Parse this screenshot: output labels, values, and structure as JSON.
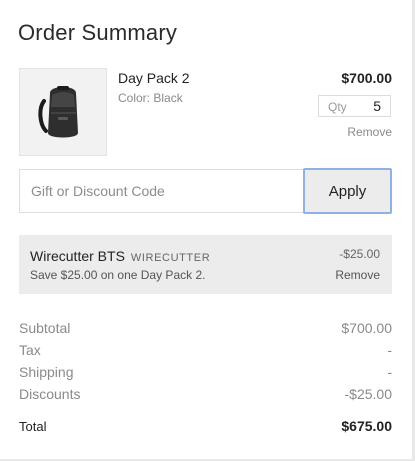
{
  "header": {
    "title": "Order Summary"
  },
  "item": {
    "name": "Day Pack 2",
    "variant": "Color: Black",
    "price": "$700.00",
    "qty_label": "Qty",
    "qty_value": "5",
    "remove_label": "Remove",
    "image_icon": "backpack-image"
  },
  "discount_form": {
    "placeholder": "Gift or Discount Code",
    "apply_label": "Apply"
  },
  "applied_discount": {
    "name": "Wirecutter BTS",
    "code": "WIRECUTTER",
    "description": "Save $25.00 on one Day Pack 2.",
    "amount": "-$25.00",
    "remove_label": "Remove"
  },
  "totals": {
    "subtotal_label": "Subtotal",
    "subtotal_value": "$700.00",
    "tax_label": "Tax",
    "tax_value": "-",
    "shipping_label": "Shipping",
    "shipping_value": "-",
    "discounts_label": "Discounts",
    "discounts_value": "-$25.00",
    "total_label": "Total",
    "total_value": "$675.00"
  },
  "colors": {
    "apply_border": "#8fb3e0",
    "discount_bg": "#ececec"
  }
}
